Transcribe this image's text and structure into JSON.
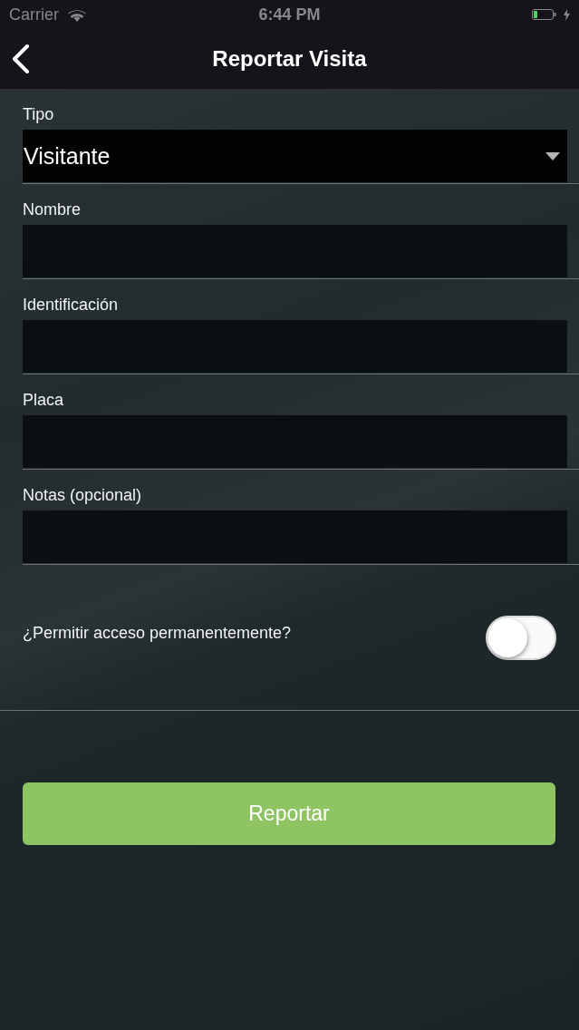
{
  "status_bar": {
    "carrier": "Carrier",
    "time": "6:44 PM"
  },
  "nav_bar": {
    "title": "Reportar Visita"
  },
  "form": {
    "fields": [
      {
        "kind": "select",
        "label": "Tipo",
        "value": "Visitante"
      },
      {
        "kind": "text",
        "label": "Nombre"
      },
      {
        "kind": "text",
        "label": "Identificación"
      },
      {
        "kind": "text",
        "label": "Placa"
      },
      {
        "kind": "text",
        "label": "Notas (opcional)"
      }
    ],
    "toggle": {
      "label": "¿Permitir acceso permanentemente?",
      "on": false
    },
    "submit_button": "Reportar"
  }
}
